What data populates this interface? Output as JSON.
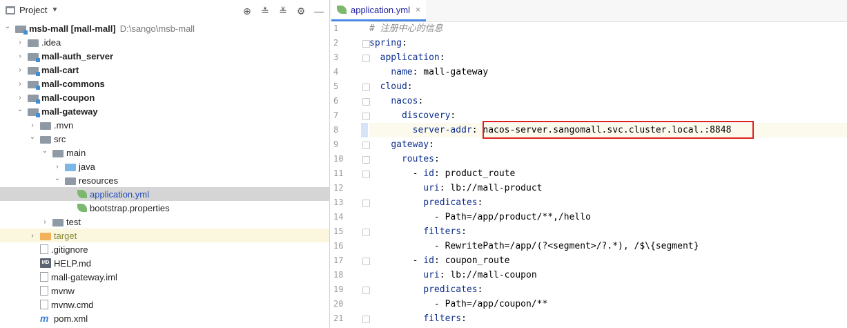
{
  "project_panel": {
    "title": "Project",
    "toolbar_icons": [
      "crosshair-icon",
      "expand-all-icon",
      "collapse-all-icon",
      "gear-icon",
      "minimize-icon"
    ]
  },
  "tree": [
    {
      "indent": 0,
      "arrow": "open",
      "icon": "folder-module",
      "label": "msb-mall [mall-mall]",
      "bold": true,
      "path": "D:\\sango\\msb-mall"
    },
    {
      "indent": 1,
      "arrow": "closed",
      "icon": "folder",
      "label": ".idea"
    },
    {
      "indent": 1,
      "arrow": "closed",
      "icon": "folder-module",
      "label": "mall-auth_server",
      "bold": true
    },
    {
      "indent": 1,
      "arrow": "closed",
      "icon": "folder-module",
      "label": "mall-cart",
      "bold": true
    },
    {
      "indent": 1,
      "arrow": "closed",
      "icon": "folder-module",
      "label": "mall-commons",
      "bold": true
    },
    {
      "indent": 1,
      "arrow": "closed",
      "icon": "folder-module",
      "label": "mall-coupon",
      "bold": true
    },
    {
      "indent": 1,
      "arrow": "open",
      "icon": "folder-module",
      "label": "mall-gateway",
      "bold": true
    },
    {
      "indent": 2,
      "arrow": "closed",
      "icon": "folder",
      "label": ".mvn"
    },
    {
      "indent": 2,
      "arrow": "open",
      "icon": "folder",
      "label": "src"
    },
    {
      "indent": 3,
      "arrow": "open",
      "icon": "folder",
      "label": "main"
    },
    {
      "indent": 4,
      "arrow": "closed",
      "icon": "folder-blue",
      "label": "java"
    },
    {
      "indent": 4,
      "arrow": "open",
      "icon": "folder",
      "label": "resources"
    },
    {
      "indent": 5,
      "arrow": "none",
      "icon": "leaf",
      "label": "application.yml",
      "selected": true,
      "color": "blue"
    },
    {
      "indent": 5,
      "arrow": "none",
      "icon": "leaf",
      "label": "bootstrap.properties"
    },
    {
      "indent": 3,
      "arrow": "closed",
      "icon": "folder",
      "label": "test"
    },
    {
      "indent": 2,
      "arrow": "closed",
      "icon": "folder-orange",
      "label": "target",
      "highlight": true,
      "color": "olive"
    },
    {
      "indent": 2,
      "arrow": "none",
      "icon": "file",
      "label": ".gitignore"
    },
    {
      "indent": 2,
      "arrow": "none",
      "icon": "md",
      "label": "HELP.md"
    },
    {
      "indent": 2,
      "arrow": "none",
      "icon": "file",
      "label": "mall-gateway.iml"
    },
    {
      "indent": 2,
      "arrow": "none",
      "icon": "file",
      "label": "mvnw"
    },
    {
      "indent": 2,
      "arrow": "none",
      "icon": "file",
      "label": "mvnw.cmd"
    },
    {
      "indent": 2,
      "arrow": "none",
      "icon": "maven",
      "label": "pom.xml"
    }
  ],
  "editor": {
    "tab_label": "application.yml",
    "lines": [
      {
        "n": "1",
        "parts": [
          {
            "t": "# 注册中心的信息",
            "c": "cm"
          }
        ]
      },
      {
        "n": "2",
        "parts": [
          {
            "t": "spring",
            "c": "k"
          },
          {
            "t": ":"
          }
        ]
      },
      {
        "n": "3",
        "parts": [
          {
            "t": "  "
          },
          {
            "t": "application",
            "c": "k"
          },
          {
            "t": ":"
          }
        ]
      },
      {
        "n": "4",
        "parts": [
          {
            "t": "    "
          },
          {
            "t": "name",
            "c": "k"
          },
          {
            "t": ": mall-gateway"
          }
        ]
      },
      {
        "n": "5",
        "parts": [
          {
            "t": "  "
          },
          {
            "t": "cloud",
            "c": "k"
          },
          {
            "t": ":"
          }
        ]
      },
      {
        "n": "6",
        "parts": [
          {
            "t": "    "
          },
          {
            "t": "nacos",
            "c": "k"
          },
          {
            "t": ":"
          }
        ]
      },
      {
        "n": "7",
        "parts": [
          {
            "t": "      "
          },
          {
            "t": "discovery",
            "c": "k"
          },
          {
            "t": ":"
          }
        ]
      },
      {
        "n": "8",
        "parts": [
          {
            "t": "        "
          },
          {
            "t": "server-addr",
            "c": "k"
          },
          {
            "t": ": nacos-server.sangomall.svc.cluster.local.:8848"
          }
        ],
        "current": true
      },
      {
        "n": "9",
        "parts": [
          {
            "t": "    "
          },
          {
            "t": "gateway",
            "c": "k"
          },
          {
            "t": ":"
          }
        ]
      },
      {
        "n": "10",
        "parts": [
          {
            "t": "      "
          },
          {
            "t": "routes",
            "c": "k"
          },
          {
            "t": ":"
          }
        ]
      },
      {
        "n": "11",
        "parts": [
          {
            "t": "        - "
          },
          {
            "t": "id",
            "c": "k"
          },
          {
            "t": ": product_route"
          }
        ]
      },
      {
        "n": "12",
        "parts": [
          {
            "t": "          "
          },
          {
            "t": "uri",
            "c": "k"
          },
          {
            "t": ": lb://mall-product"
          }
        ]
      },
      {
        "n": "13",
        "parts": [
          {
            "t": "          "
          },
          {
            "t": "predicates",
            "c": "k"
          },
          {
            "t": ":"
          }
        ]
      },
      {
        "n": "14",
        "parts": [
          {
            "t": "            - Path=/app/product/**,/hello"
          }
        ]
      },
      {
        "n": "15",
        "parts": [
          {
            "t": "          "
          },
          {
            "t": "filters",
            "c": "k"
          },
          {
            "t": ":"
          }
        ]
      },
      {
        "n": "16",
        "parts": [
          {
            "t": "            - RewritePath=/app/(?<segment>/?.*), /$\\{segment}"
          }
        ]
      },
      {
        "n": "17",
        "parts": [
          {
            "t": "        - "
          },
          {
            "t": "id",
            "c": "k"
          },
          {
            "t": ": coupon_route"
          }
        ]
      },
      {
        "n": "18",
        "parts": [
          {
            "t": "          "
          },
          {
            "t": "uri",
            "c": "k"
          },
          {
            "t": ": lb://mall-coupon"
          }
        ]
      },
      {
        "n": "19",
        "parts": [
          {
            "t": "          "
          },
          {
            "t": "predicates",
            "c": "k"
          },
          {
            "t": ":"
          }
        ]
      },
      {
        "n": "20",
        "parts": [
          {
            "t": "            - Path=/app/coupon/**"
          }
        ]
      },
      {
        "n": "21",
        "parts": [
          {
            "t": "          "
          },
          {
            "t": "filters",
            "c": "k"
          },
          {
            "t": ":"
          }
        ]
      }
    ]
  },
  "colors": {
    "keyword": "#0b2d8c",
    "comment": "#8c8c8c",
    "highlight_box": "#e02020",
    "selection": "#d5d5d5"
  }
}
